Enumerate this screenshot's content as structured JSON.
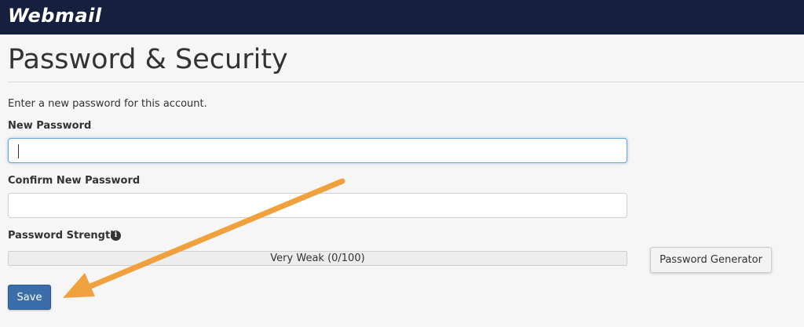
{
  "header": {
    "brand": "Webmail"
  },
  "page": {
    "title": "Password & Security",
    "intro": "Enter a new password for this account."
  },
  "form": {
    "new_password_label": "New Password",
    "new_password_value": "",
    "confirm_password_label": "Confirm New Password",
    "confirm_password_value": "",
    "strength_label": "Password Strength",
    "strength_text": "Very Weak (0/100)",
    "strength_value": 0,
    "strength_max": 100,
    "generator_button": "Password Generator",
    "save_button": "Save"
  },
  "icons": {
    "info": "info-icon"
  },
  "colors": {
    "header_bg": "#161f3d",
    "save_button": "#3b6ea8",
    "annotation_arrow": "#f0a03c",
    "focus_border": "#66a3e0"
  }
}
